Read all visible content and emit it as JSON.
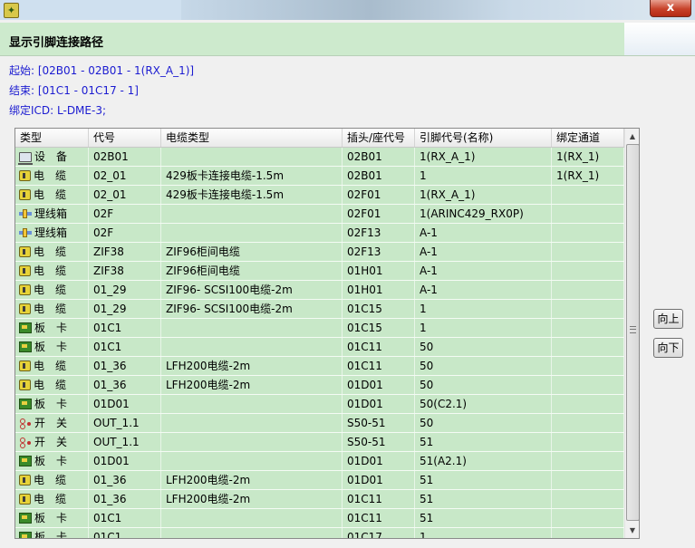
{
  "window": {
    "close_label": "x"
  },
  "header": {
    "title": "显示引脚连接路径"
  },
  "info": {
    "start": "起始: [02B01 - 02B01 - 1(RX_A_1)]",
    "end": "结束: [01C1 - 01C17 - 1]",
    "icd": "绑定ICD: L-DME-3;"
  },
  "table": {
    "columns": [
      "类型",
      "代号",
      "电缆类型",
      "插头/座代号",
      "引脚代号(名称)",
      "绑定通道"
    ],
    "rows": [
      {
        "icon": "device",
        "type": "设　备",
        "code": "02B01",
        "cable": "",
        "connector": "02B01",
        "pin": "1(RX_A_1)",
        "channel": "1(RX_1)"
      },
      {
        "icon": "cable",
        "type": "电　缆",
        "code": "02_01",
        "cable": "429板卡连接电缆-1.5m",
        "connector": "02B01",
        "pin": "1",
        "channel": "1(RX_1)"
      },
      {
        "icon": "cable",
        "type": "电　缆",
        "code": "02_01",
        "cable": "429板卡连接电缆-1.5m",
        "connector": "02F01",
        "pin": "1(RX_A_1)",
        "channel": ""
      },
      {
        "icon": "box",
        "type": "理线箱",
        "code": "02F",
        "cable": "",
        "connector": "02F01",
        "pin": "1(ARINC429_RX0P)",
        "channel": ""
      },
      {
        "icon": "box",
        "type": "理线箱",
        "code": "02F",
        "cable": "",
        "connector": "02F13",
        "pin": "A-1",
        "channel": ""
      },
      {
        "icon": "cable",
        "type": "电　缆",
        "code": "ZIF38",
        "cable": "ZIF96柜间电缆",
        "connector": "02F13",
        "pin": "A-1",
        "channel": ""
      },
      {
        "icon": "cable",
        "type": "电　缆",
        "code": "ZIF38",
        "cable": "ZIF96柜间电缆",
        "connector": "01H01",
        "pin": "A-1",
        "channel": ""
      },
      {
        "icon": "cable",
        "type": "电　缆",
        "code": "01_29",
        "cable": "ZIF96- SCSI100电缆-2m",
        "connector": "01H01",
        "pin": "A-1",
        "channel": ""
      },
      {
        "icon": "cable",
        "type": "电　缆",
        "code": "01_29",
        "cable": "ZIF96- SCSI100电缆-2m",
        "connector": "01C15",
        "pin": "1",
        "channel": ""
      },
      {
        "icon": "card",
        "type": "板　卡",
        "code": "01C1",
        "cable": "",
        "connector": "01C15",
        "pin": "1",
        "channel": ""
      },
      {
        "icon": "card",
        "type": "板　卡",
        "code": "01C1",
        "cable": "",
        "connector": "01C11",
        "pin": "50",
        "channel": ""
      },
      {
        "icon": "cable",
        "type": "电　缆",
        "code": "01_36",
        "cable": "LFH200电缆-2m",
        "connector": "01C11",
        "pin": "50",
        "channel": ""
      },
      {
        "icon": "cable",
        "type": "电　缆",
        "code": "01_36",
        "cable": "LFH200电缆-2m",
        "connector": "01D01",
        "pin": "50",
        "channel": ""
      },
      {
        "icon": "card",
        "type": "板　卡",
        "code": "01D01",
        "cable": "",
        "connector": "01D01",
        "pin": "50(C2.1)",
        "channel": ""
      },
      {
        "icon": "switch",
        "type": "开　关",
        "code": "OUT_1.1",
        "cable": "",
        "connector": "S50-51",
        "pin": "50",
        "channel": ""
      },
      {
        "icon": "switch",
        "type": "开　关",
        "code": "OUT_1.1",
        "cable": "",
        "connector": "S50-51",
        "pin": "51",
        "channel": ""
      },
      {
        "icon": "card",
        "type": "板　卡",
        "code": "01D01",
        "cable": "",
        "connector": "01D01",
        "pin": "51(A2.1)",
        "channel": ""
      },
      {
        "icon": "cable",
        "type": "电　缆",
        "code": "01_36",
        "cable": "LFH200电缆-2m",
        "connector": "01D01",
        "pin": "51",
        "channel": ""
      },
      {
        "icon": "cable",
        "type": "电　缆",
        "code": "01_36",
        "cable": "LFH200电缆-2m",
        "connector": "01C11",
        "pin": "51",
        "channel": ""
      },
      {
        "icon": "card",
        "type": "板　卡",
        "code": "01C1",
        "cable": "",
        "connector": "01C11",
        "pin": "51",
        "channel": ""
      },
      {
        "icon": "card",
        "type": "板　卡",
        "code": "01C1",
        "cable": "",
        "connector": "01C17",
        "pin": "1",
        "channel": ""
      }
    ]
  },
  "buttons": {
    "up": "向上",
    "down": "向下"
  },
  "colors": {
    "header_bg": "#cdeacd",
    "row_bg": "#c8e8c8",
    "info_text": "#1b1bd1"
  }
}
